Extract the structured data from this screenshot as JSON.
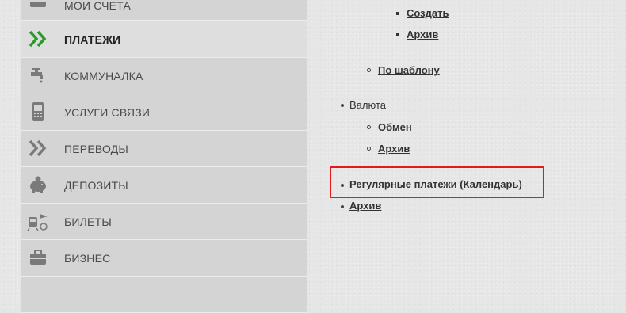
{
  "sidebar": {
    "items": [
      {
        "label": "МОИ СЧЕТА",
        "icon": "card-icon",
        "active": false
      },
      {
        "label": "ПЛАТЕЖИ",
        "icon": "double-chevron-icon",
        "active": true
      },
      {
        "label": "КОММУНАЛКА",
        "icon": "faucet-icon",
        "active": false
      },
      {
        "label": "УСЛУГИ СВЯЗИ",
        "icon": "mobile-phone-icon",
        "active": false
      },
      {
        "label": "ПЕРЕВОДЫ",
        "icon": "double-chevron-icon",
        "active": false
      },
      {
        "label": "ДЕПОЗИТЫ",
        "icon": "piggy-bank-icon",
        "active": false
      },
      {
        "label": "БИЛЕТЫ",
        "icon": "train-plane-icon",
        "active": false
      },
      {
        "label": "БИЗНЕС",
        "icon": "briefcase-icon",
        "active": false
      }
    ]
  },
  "content": {
    "create_link": "Создать",
    "archive_link_1": "Архив",
    "by_template_link": "По шаблону",
    "currency_label": "Валюта",
    "exchange_link": "Обмен",
    "archive_link_2": "Архив",
    "regular_payments_link": "Регулярные платежи (Календарь)",
    "archive_link_3": "Архив"
  },
  "colors": {
    "accent_green": "#2a9a2a",
    "highlight_red": "#e01b1b",
    "sidebar_bg": "#d4d4d4",
    "page_bg": "#e6e6e6"
  }
}
